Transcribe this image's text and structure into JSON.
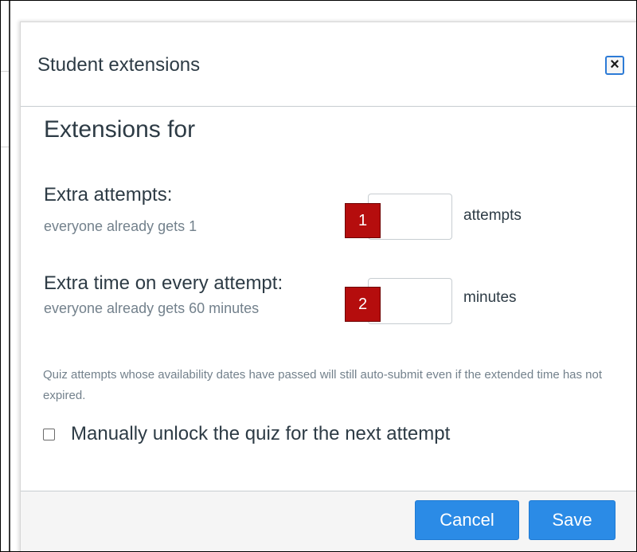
{
  "modal": {
    "title": "Student extensions",
    "close_icon": "×"
  },
  "form": {
    "heading": "Extensions for",
    "extra_attempts": {
      "label": "Extra attempts:",
      "help": "everyone already gets 1",
      "value": "",
      "badge": "1",
      "unit": "attempts"
    },
    "extra_time": {
      "label": "Extra time on every attempt:",
      "help": "everyone already gets 60 minutes",
      "value": "",
      "badge": "2",
      "unit": "minutes"
    },
    "note": "Quiz attempts whose availability dates have passed will still auto-submit even if the extended time has not expired.",
    "manual_unlock": {
      "label": "Manually unlock the quiz for the next attempt",
      "checked": false
    }
  },
  "footer": {
    "cancel_label": "Cancel",
    "save_label": "Save"
  },
  "colors": {
    "primary_button": "#2b8be6",
    "badge": "#b50d0d",
    "text": "#2d3b45",
    "muted_text": "#73818c",
    "focus_ring": "#2d7bd6"
  },
  "icons": {
    "close": "close-icon",
    "checkbox": "checkbox-icon"
  }
}
